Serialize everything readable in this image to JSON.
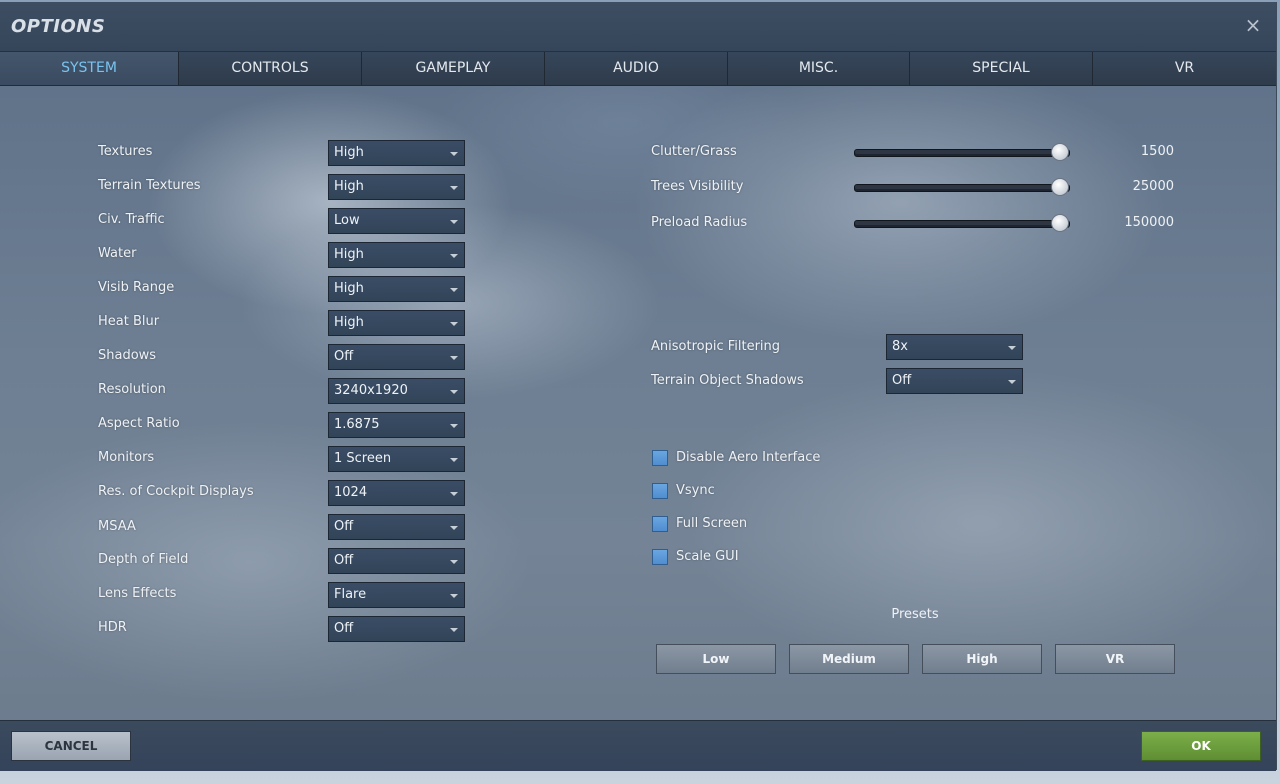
{
  "window": {
    "title": "OPTIONS",
    "close_glyph": "×"
  },
  "tabs": [
    {
      "label": "SYSTEM",
      "active": true
    },
    {
      "label": "CONTROLS",
      "active": false
    },
    {
      "label": "GAMEPLAY",
      "active": false
    },
    {
      "label": "AUDIO",
      "active": false
    },
    {
      "label": "MISC.",
      "active": false
    },
    {
      "label": "SPECIAL",
      "active": false
    },
    {
      "label": "VR",
      "active": false
    }
  ],
  "left_settings": [
    {
      "label": "Textures",
      "value": "High"
    },
    {
      "label": "Terrain Textures",
      "value": "High"
    },
    {
      "label": "Civ. Traffic",
      "value": "Low"
    },
    {
      "label": "Water",
      "value": "High"
    },
    {
      "label": "Visib Range",
      "value": "High"
    },
    {
      "label": "Heat Blur",
      "value": "High"
    },
    {
      "label": "Shadows",
      "value": "Off"
    },
    {
      "label": "Resolution",
      "value": "3240x1920"
    },
    {
      "label": "Aspect Ratio",
      "value": "1.6875"
    },
    {
      "label": "Monitors",
      "value": "1 Screen"
    },
    {
      "label": "Res. of Cockpit Displays",
      "value": "1024"
    },
    {
      "label": "MSAA",
      "value": "Off"
    },
    {
      "label": "Depth of Field",
      "value": "Off"
    },
    {
      "label": "Lens Effects",
      "value": "Flare"
    },
    {
      "label": "HDR",
      "value": "Off"
    }
  ],
  "sliders": [
    {
      "label": "Clutter/Grass",
      "value": "1500",
      "position": 0.96
    },
    {
      "label": "Trees Visibility",
      "value": "25000",
      "position": 0.96
    },
    {
      "label": "Preload Radius",
      "value": "150000",
      "position": 0.96
    }
  ],
  "right_selects": [
    {
      "label": "Anisotropic Filtering",
      "value": "8x"
    },
    {
      "label": "Terrain Object Shadows",
      "value": "Off"
    }
  ],
  "checkboxes": [
    {
      "label": "Disable Aero Interface",
      "checked": false
    },
    {
      "label": "Vsync",
      "checked": false
    },
    {
      "label": "Full Screen",
      "checked": false
    },
    {
      "label": "Scale GUI",
      "checked": false
    }
  ],
  "presets": {
    "label": "Presets",
    "buttons": [
      "Low",
      "Medium",
      "High",
      "VR"
    ]
  },
  "footer": {
    "cancel_label": "CANCEL",
    "ok_label": "OK"
  },
  "colors": {
    "active_tab": "#79c3ef",
    "ok_button": "#6a9c3c",
    "checkbox": "#5b98d8"
  }
}
